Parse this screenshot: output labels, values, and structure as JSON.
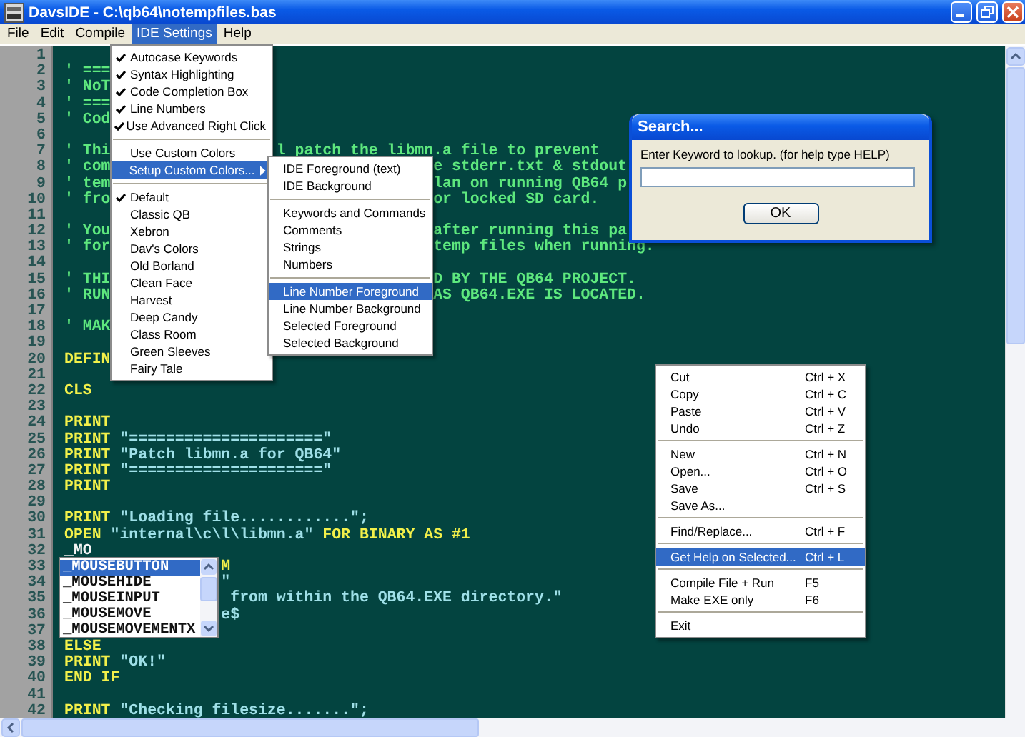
{
  "window": {
    "title": "DavsIDE - C:\\qb64\\notempfiles.bas"
  },
  "menu_bar": [
    {
      "label": "File",
      "selected": false
    },
    {
      "label": "Edit",
      "selected": false
    },
    {
      "label": "Compile",
      "selected": false
    },
    {
      "label": "IDE Settings",
      "selected": true
    },
    {
      "label": "Help",
      "selected": false
    }
  ],
  "editor": {
    "lines": [
      {
        "number": "1"
      },
      {
        "number": "2",
        "parts": [
          {
            "kind": "comment",
            "text": "' ==="
          }
        ]
      },
      {
        "number": "3",
        "parts": [
          {
            "kind": "comment",
            "text": "' NoT"
          }
        ]
      },
      {
        "number": "4",
        "parts": [
          {
            "kind": "comment",
            "text": "' ==="
          }
        ]
      },
      {
        "number": "5",
        "parts": [
          {
            "kind": "comment",
            "text": "' Cod"
          }
        ]
      },
      {
        "number": "6"
      },
      {
        "number": "7",
        "parts": [
          {
            "kind": "comment",
            "text": "' Thi"
          },
          {
            "kind": "comment",
            "text": "                  l patch the libmn.a file to prevent"
          }
        ]
      },
      {
        "number": "8",
        "parts": [
          {
            "kind": "comment",
            "text": "' com"
          },
          {
            "kind": "comment",
            "text": "                                   e stderr.txt & stdout"
          }
        ]
      },
      {
        "number": "9",
        "parts": [
          {
            "kind": "comment",
            "text": "' tem"
          },
          {
            "kind": "comment",
            "text": "                                   lan on running QB64 p"
          }
        ]
      },
      {
        "number": "10",
        "parts": [
          {
            "kind": "comment",
            "text": "' fro"
          },
          {
            "kind": "comment",
            "text": "                                   or locked SD card."
          }
        ]
      },
      {
        "number": "11"
      },
      {
        "number": "12",
        "parts": [
          {
            "kind": "comment",
            "text": "' You"
          },
          {
            "kind": "comment",
            "text": "                                   after running this pa"
          }
        ]
      },
      {
        "number": "13",
        "parts": [
          {
            "kind": "comment",
            "text": "' for"
          },
          {
            "kind": "comment",
            "text": "                                   temp files when running."
          }
        ]
      },
      {
        "number": "14"
      },
      {
        "number": "15",
        "parts": [
          {
            "kind": "comment",
            "text": "' THI"
          },
          {
            "kind": "comment",
            "text": "                                   D BY THE QB64 PROJECT."
          }
        ]
      },
      {
        "number": "16",
        "parts": [
          {
            "kind": "comment",
            "text": "' RUN"
          },
          {
            "kind": "comment",
            "text": "                                   AS QB64.EXE IS LOCATED."
          }
        ]
      },
      {
        "number": "17"
      },
      {
        "number": "18",
        "parts": [
          {
            "kind": "comment",
            "text": "' MAK"
          }
        ]
      },
      {
        "number": "19"
      },
      {
        "number": "20",
        "parts": [
          {
            "kind": "keyword",
            "text": "DEFIN"
          }
        ]
      },
      {
        "number": "21"
      },
      {
        "number": "22",
        "parts": [
          {
            "kind": "keyword",
            "text": "CLS"
          }
        ]
      },
      {
        "number": "23"
      },
      {
        "number": "24",
        "parts": [
          {
            "kind": "keyword",
            "text": "PRINT"
          }
        ]
      },
      {
        "number": "25",
        "parts": [
          {
            "kind": "keyword",
            "text": "PRINT"
          },
          {
            "kind": "string",
            "text": " \"=====================\""
          }
        ]
      },
      {
        "number": "26",
        "parts": [
          {
            "kind": "keyword",
            "text": "PRINT"
          },
          {
            "kind": "string",
            "text": " \"Patch libmn.a for QB64\""
          }
        ]
      },
      {
        "number": "27",
        "parts": [
          {
            "kind": "keyword",
            "text": "PRINT"
          },
          {
            "kind": "string",
            "text": " \"=====================\""
          }
        ]
      },
      {
        "number": "28",
        "parts": [
          {
            "kind": "keyword",
            "text": "PRINT"
          }
        ]
      },
      {
        "number": "29"
      },
      {
        "number": "30",
        "parts": [
          {
            "kind": "keyword",
            "text": "PRINT"
          },
          {
            "kind": "string",
            "text": " \"Loading file............\";"
          }
        ]
      },
      {
        "number": "31",
        "parts": [
          {
            "kind": "keyword",
            "text": "OPEN"
          },
          {
            "kind": "string",
            "text": " \"internal\\c\\l\\libmn.a\""
          },
          {
            "kind": "keyword",
            "text": " FOR BINARY AS #1"
          }
        ]
      },
      {
        "number": "32",
        "parts": [
          {
            "kind": "plain",
            "text": "_MO"
          }
        ]
      },
      {
        "number": "33",
        "parts": [
          {
            "kind": "keyword",
            "text": "                 M"
          }
        ]
      },
      {
        "number": "34",
        "parts": [
          {
            "kind": "string",
            "text": "                 \""
          }
        ]
      },
      {
        "number": "35",
        "parts": [
          {
            "kind": "string",
            "text": "                  from within the QB64.EXE directory.\""
          }
        ]
      },
      {
        "number": "36",
        "parts": [
          {
            "kind": "string",
            "text": "                 e$"
          }
        ]
      },
      {
        "number": "37"
      },
      {
        "number": "38",
        "parts": [
          {
            "kind": "keyword",
            "text": "ELSE"
          }
        ]
      },
      {
        "number": "39",
        "parts": [
          {
            "kind": "keyword",
            "text": "PRINT"
          },
          {
            "kind": "string",
            "text": " \"OK!\""
          }
        ]
      },
      {
        "number": "40",
        "parts": [
          {
            "kind": "keyword",
            "text": "END IF"
          }
        ]
      },
      {
        "number": "41"
      },
      {
        "number": "42",
        "parts": [
          {
            "kind": "keyword",
            "text": "PRINT"
          },
          {
            "kind": "string",
            "text": " \"Checking filesize.......\";"
          }
        ]
      }
    ]
  },
  "settings_menu": [
    {
      "kind": "item",
      "label": "Autocase Keywords",
      "checked": true,
      "selected": false
    },
    {
      "kind": "item",
      "label": "Syntax Highlighting",
      "checked": true,
      "selected": false
    },
    {
      "kind": "item",
      "label": "Code Completion Box",
      "checked": true,
      "selected": false
    },
    {
      "kind": "item",
      "label": "Line Numbers",
      "checked": true,
      "selected": false
    },
    {
      "kind": "item",
      "label": "Use Advanced Right Click",
      "checked": true,
      "selected": false
    },
    {
      "kind": "separator"
    },
    {
      "kind": "item",
      "label": "Use Custom Colors",
      "checked": false,
      "selected": false
    },
    {
      "kind": "submenu",
      "label": "Setup Custom Colors...",
      "checked": false,
      "selected": true
    },
    {
      "kind": "separator"
    },
    {
      "kind": "item",
      "label": "Default",
      "checked": true,
      "selected": false
    },
    {
      "kind": "item",
      "label": "Classic QB",
      "checked": false,
      "selected": false
    },
    {
      "kind": "item",
      "label": "Xebron",
      "checked": false,
      "selected": false
    },
    {
      "kind": "item",
      "label": "Dav's Colors",
      "checked": false,
      "selected": false
    },
    {
      "kind": "item",
      "label": "Old Borland",
      "checked": false,
      "selected": false
    },
    {
      "kind": "item",
      "label": "Clean Face",
      "checked": false,
      "selected": false
    },
    {
      "kind": "item",
      "label": "Harvest",
      "checked": false,
      "selected": false
    },
    {
      "kind": "item",
      "label": "Deep Candy",
      "checked": false,
      "selected": false
    },
    {
      "kind": "item",
      "label": "Class Room",
      "checked": false,
      "selected": false
    },
    {
      "kind": "item",
      "label": "Green Sleeves",
      "checked": false,
      "selected": false
    },
    {
      "kind": "item",
      "label": "Fairy Tale",
      "checked": false,
      "selected": false
    }
  ],
  "colors_submenu": [
    {
      "kind": "item",
      "label": "IDE Foreground (text)",
      "selected": false
    },
    {
      "kind": "item",
      "label": "IDE Background",
      "selected": false
    },
    {
      "kind": "separator"
    },
    {
      "kind": "item",
      "label": "Keywords and Commands",
      "selected": false
    },
    {
      "kind": "item",
      "label": "Comments",
      "selected": false
    },
    {
      "kind": "item",
      "label": "Strings",
      "selected": false
    },
    {
      "kind": "item",
      "label": "Numbers",
      "selected": false
    },
    {
      "kind": "separator"
    },
    {
      "kind": "item",
      "label": "Line Number Foreground",
      "selected": true
    },
    {
      "kind": "item",
      "label": "Line Number Background",
      "selected": false
    },
    {
      "kind": "item",
      "label": "Selected Foreground",
      "selected": false
    },
    {
      "kind": "item",
      "label": "Selected Background",
      "selected": false
    }
  ],
  "search_dialog": {
    "title": "Search...",
    "prompt": "Enter Keyword to lookup. (for help type HELP)",
    "button": "OK"
  },
  "context_menu": [
    {
      "kind": "item",
      "label": "Cut",
      "shortcut": "Ctrl + X",
      "selected": false
    },
    {
      "kind": "item",
      "label": "Copy",
      "shortcut": "Ctrl + C",
      "selected": false
    },
    {
      "kind": "item",
      "label": "Paste",
      "shortcut": "Ctrl + V",
      "selected": false
    },
    {
      "kind": "item",
      "label": "Undo",
      "shortcut": "Ctrl + Z",
      "selected": false
    },
    {
      "kind": "separator"
    },
    {
      "kind": "item",
      "label": "New",
      "shortcut": "Ctrl + N",
      "selected": false
    },
    {
      "kind": "item",
      "label": "Open...",
      "shortcut": "Ctrl + O",
      "selected": false
    },
    {
      "kind": "item",
      "label": "Save",
      "shortcut": "Ctrl + S",
      "selected": false
    },
    {
      "kind": "item",
      "label": "Save As...",
      "selected": false
    },
    {
      "kind": "separator"
    },
    {
      "kind": "item",
      "label": "Find/Replace...",
      "shortcut": "Ctrl + F",
      "selected": false
    },
    {
      "kind": "separator"
    },
    {
      "kind": "item",
      "label": "Get Help on Selected...",
      "shortcut": "Ctrl + L",
      "selected": true
    },
    {
      "kind": "separator"
    },
    {
      "kind": "item",
      "label": "Compile File + Run",
      "shortcut": "F5",
      "selected": false
    },
    {
      "kind": "item",
      "label": "Make EXE only",
      "shortcut": "F6",
      "selected": false
    },
    {
      "kind": "separator"
    },
    {
      "kind": "item",
      "label": "Exit",
      "selected": false
    }
  ],
  "completion_list": [
    {
      "label": "_MOUSEBUTTON",
      "selected": true
    },
    {
      "label": "_MOUSEHIDE",
      "selected": false
    },
    {
      "label": "_MOUSEINPUT",
      "selected": false
    },
    {
      "label": "_MOUSEMOVE",
      "selected": false
    },
    {
      "label": "_MOUSEMOVEMENTX",
      "selected": false
    }
  ]
}
